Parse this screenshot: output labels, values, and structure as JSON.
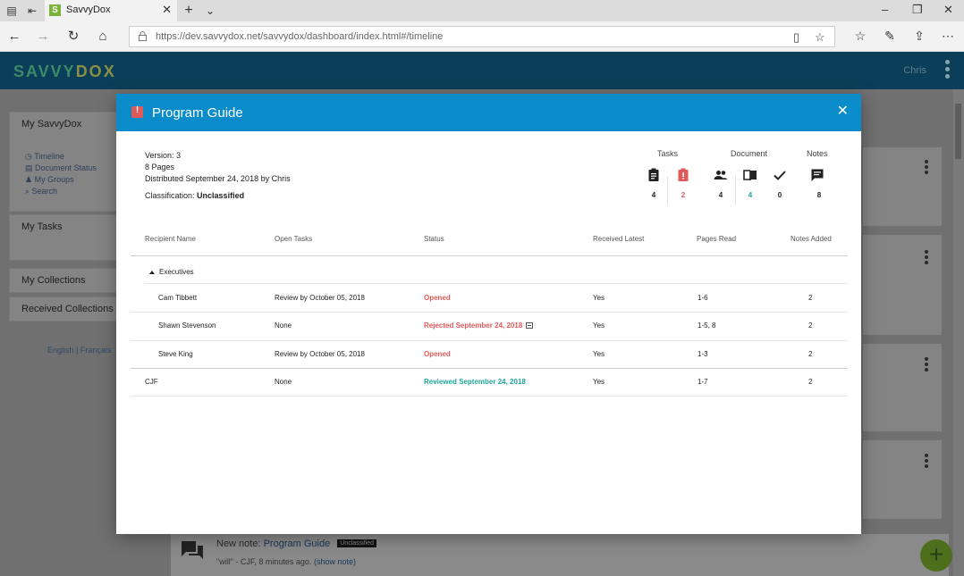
{
  "browser": {
    "tab_title": "SavvyDox",
    "tab_favicon": "S",
    "url": "https://dev.savvydox.net/savvydox/dashboard/index.html#/timeline"
  },
  "app": {
    "logo_left": "SAVVY",
    "logo_right": "DOX",
    "user": "Chris"
  },
  "sidebar": {
    "my_savvydox": "My SavvyDox",
    "links": [
      "Timeline",
      "Document Status",
      "My Groups",
      "Search"
    ],
    "my_tasks": "My Tasks",
    "my_collections": "My Collections",
    "received_collections": "Received Collections",
    "lang_english": "English",
    "lang_sep": "|",
    "lang_french": "Français"
  },
  "timeline_note": {
    "prefix": "New note:",
    "doc_link": "Program Guide",
    "badge": "Unclassified",
    "quote": "\"will\" - CJF, 8 minutes ago.",
    "show_note": "(show note)"
  },
  "modal": {
    "title": "Program Guide",
    "version": "Version: 3",
    "pages": "8 Pages",
    "distributed": "Distributed September 24, 2018 by Chris",
    "classification_label": "Classification:",
    "classification_value": "Unclassified",
    "stats": {
      "tasks_label": "Tasks",
      "document_label": "Document",
      "notes_label": "Notes",
      "tasks_total": "4",
      "tasks_urgent": "2",
      "recipients": "4",
      "read": "4",
      "reviewed": "0",
      "notes": "8"
    },
    "columns": [
      "Recipient Name",
      "Open Tasks",
      "Status",
      "Received Latest",
      "Pages Read",
      "Notes Added"
    ],
    "group_name": "Executives",
    "rows": [
      {
        "name": "Cam Tibbett",
        "tasks": "Review by October 05, 2018",
        "status": "Opened",
        "received": "Yes",
        "pages": "1-6",
        "notes": "2"
      },
      {
        "name": "Shawn Stevenson",
        "tasks": "None",
        "status": "Rejected September 24, 2018",
        "received": "Yes",
        "pages": "1-5, 8",
        "notes": "2"
      },
      {
        "name": "Steve King",
        "tasks": "Review by October 05, 2018",
        "status": "Opened",
        "received": "Yes",
        "pages": "1-3",
        "notes": "2"
      },
      {
        "name": "CJF",
        "tasks": "None",
        "status": "Reviewed September 24, 2018",
        "received": "Yes",
        "pages": "1-7",
        "notes": "2"
      }
    ]
  },
  "colors": {
    "modal_header": "#0a8ccb",
    "status_opened": "#e05a5a",
    "status_reviewed": "#1fa89a",
    "fab": "#4d6f1c"
  }
}
